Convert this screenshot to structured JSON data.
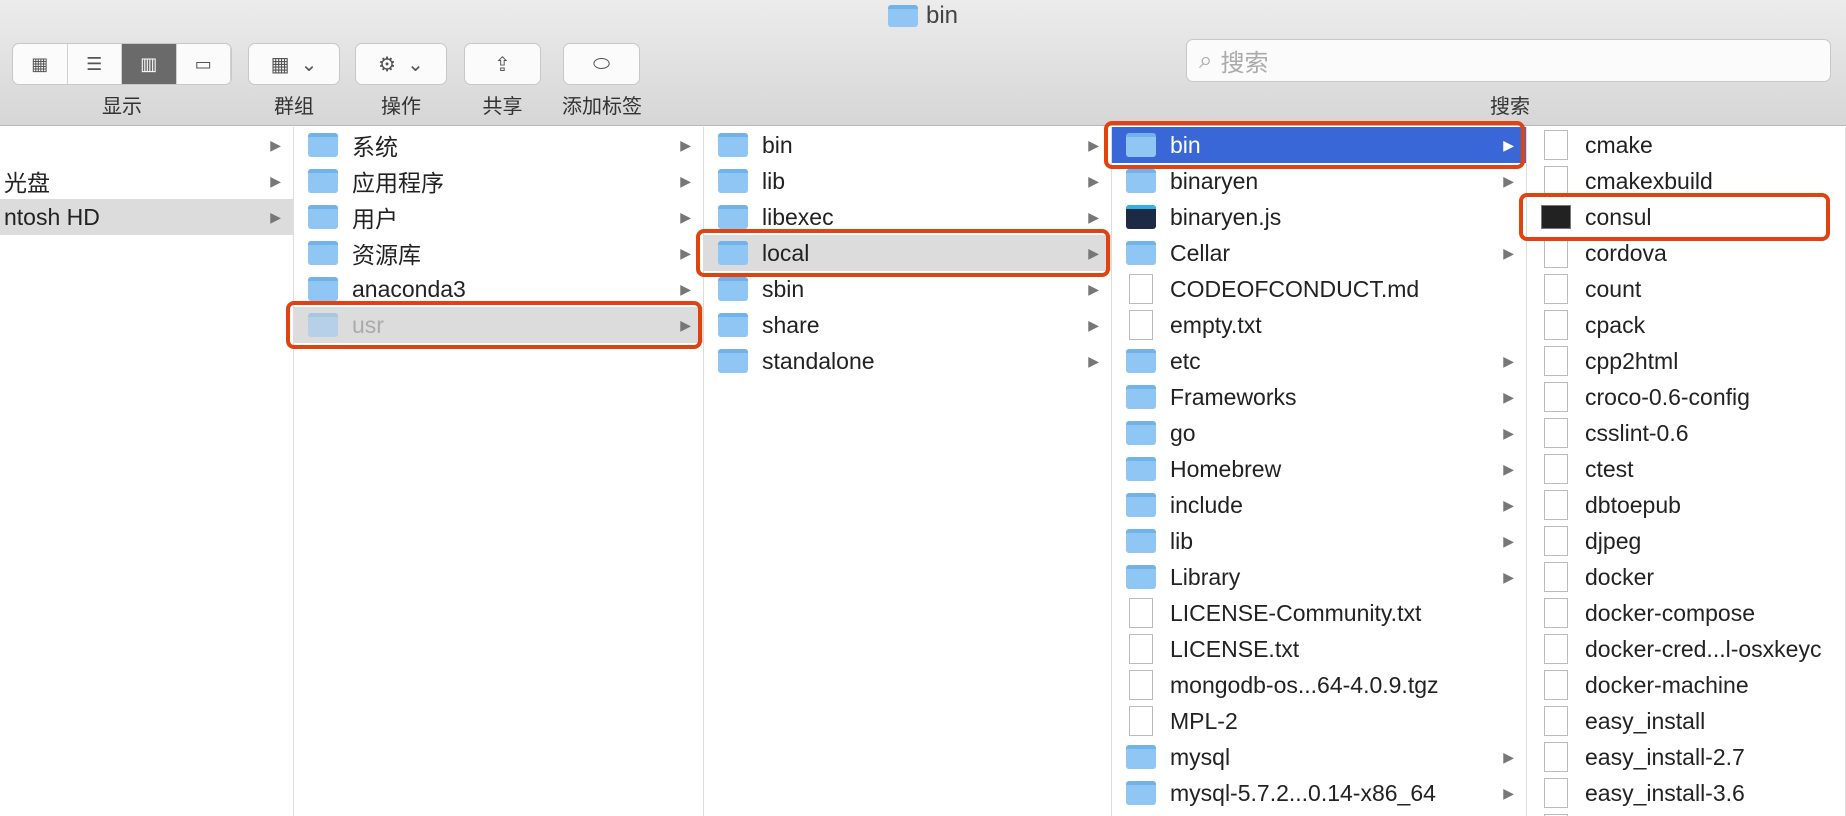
{
  "window": {
    "title": "bin"
  },
  "toolbar": {
    "view_label": "显示",
    "group_label": "群组",
    "action_label": "操作",
    "share_label": "共享",
    "tag_label": "添加标签",
    "search_placeholder": "搜索",
    "search_label": "搜索"
  },
  "columns": [
    {
      "items": [
        {
          "name": "",
          "arrow": true
        },
        {
          "name": "光盘",
          "arrow": true
        },
        {
          "name": "ntosh HD",
          "arrow": true,
          "selected": "gray"
        }
      ]
    },
    {
      "items": [
        {
          "name": "系统",
          "arrow": true
        },
        {
          "name": "应用程序",
          "arrow": true
        },
        {
          "name": "用户",
          "arrow": true
        },
        {
          "name": "资源库",
          "arrow": true
        },
        {
          "name": "anaconda3",
          "arrow": true
        },
        {
          "name": "usr",
          "arrow": true,
          "selected": "gray",
          "highlight": true
        }
      ]
    },
    {
      "items": [
        {
          "name": "bin",
          "arrow": true
        },
        {
          "name": "lib",
          "arrow": true
        },
        {
          "name": "libexec",
          "arrow": true
        },
        {
          "name": "local",
          "arrow": true,
          "selected": "gray",
          "highlight": true
        },
        {
          "name": "sbin",
          "arrow": true
        },
        {
          "name": "share",
          "arrow": true
        },
        {
          "name": "standalone",
          "arrow": true
        }
      ]
    },
    {
      "items": [
        {
          "name": "bin",
          "arrow": true,
          "selected": "blue",
          "highlight": true,
          "icon": "folder"
        },
        {
          "name": "binaryen",
          "arrow": true,
          "icon": "folder"
        },
        {
          "name": "binaryen.js",
          "icon": "webstorm"
        },
        {
          "name": "Cellar",
          "arrow": true,
          "icon": "folder"
        },
        {
          "name": "CODEOFCONDUCT.md",
          "icon": "doc"
        },
        {
          "name": "empty.txt",
          "icon": "doc"
        },
        {
          "name": "etc",
          "arrow": true,
          "icon": "folder"
        },
        {
          "name": "Frameworks",
          "arrow": true,
          "icon": "folder"
        },
        {
          "name": "go",
          "arrow": true,
          "icon": "folder"
        },
        {
          "name": "Homebrew",
          "arrow": true,
          "icon": "folder"
        },
        {
          "name": "include",
          "arrow": true,
          "icon": "folder"
        },
        {
          "name": "lib",
          "arrow": true,
          "icon": "folder"
        },
        {
          "name": "Library",
          "arrow": true,
          "icon": "folder"
        },
        {
          "name": "LICENSE-Community.txt",
          "icon": "doc"
        },
        {
          "name": "LICENSE.txt",
          "icon": "doc"
        },
        {
          "name": "mongodb-os...64-4.0.9.tgz",
          "icon": "doc"
        },
        {
          "name": "MPL-2",
          "icon": "doc"
        },
        {
          "name": "mysql",
          "arrow": true,
          "icon": "folder"
        },
        {
          "name": "mysql-5.7.2...0.14-x86_64",
          "arrow": true,
          "icon": "folder"
        }
      ]
    },
    {
      "items": [
        {
          "name": "cmake",
          "icon": "doc"
        },
        {
          "name": "cmakexbuild",
          "icon": "doc"
        },
        {
          "name": "consul",
          "icon": "terminal",
          "highlight": true
        },
        {
          "name": "cordova",
          "icon": "doc"
        },
        {
          "name": "count",
          "icon": "doc"
        },
        {
          "name": "cpack",
          "icon": "doc"
        },
        {
          "name": "cpp2html",
          "icon": "doc"
        },
        {
          "name": "croco-0.6-config",
          "icon": "doc"
        },
        {
          "name": "csslint-0.6",
          "icon": "doc"
        },
        {
          "name": "ctest",
          "icon": "doc"
        },
        {
          "name": "dbtoepub",
          "icon": "doc"
        },
        {
          "name": "djpeg",
          "icon": "doc"
        },
        {
          "name": "docker",
          "icon": "doc"
        },
        {
          "name": "docker-compose",
          "icon": "doc"
        },
        {
          "name": "docker-cred...l-osxkeyc",
          "icon": "doc"
        },
        {
          "name": "docker-machine",
          "icon": "doc"
        },
        {
          "name": "easy_install",
          "icon": "doc"
        },
        {
          "name": "easy_install-2.7",
          "icon": "doc"
        },
        {
          "name": "easy_install-3.6",
          "icon": "doc"
        },
        {
          "name": "",
          "icon": "doc"
        }
      ]
    }
  ],
  "colors": {
    "selection_blue": "#3a67d8",
    "selection_gray": "#dcdcdc",
    "highlight_red": "#e0430f",
    "folder": "#8fc6f3"
  }
}
